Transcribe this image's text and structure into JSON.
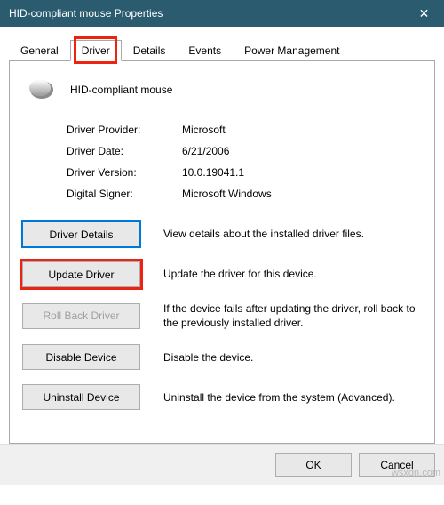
{
  "titlebar": {
    "text": "HID-compliant mouse Properties",
    "close_glyph": "✕"
  },
  "tabs": {
    "general": "General",
    "driver": "Driver",
    "details": "Details",
    "events": "Events",
    "power": "Power Management"
  },
  "device": {
    "name": "HID-compliant mouse"
  },
  "info": {
    "provider_label": "Driver Provider:",
    "provider_value": "Microsoft",
    "date_label": "Driver Date:",
    "date_value": "6/21/2006",
    "version_label": "Driver Version:",
    "version_value": "10.0.19041.1",
    "signer_label": "Digital Signer:",
    "signer_value": "Microsoft Windows"
  },
  "buttons": {
    "details_label": "Driver Details",
    "details_desc": "View details about the installed driver files.",
    "update_label": "Update Driver",
    "update_desc": "Update the driver for this device.",
    "rollback_label": "Roll Back Driver",
    "rollback_desc": "If the device fails after updating the driver, roll back to the previously installed driver.",
    "disable_label": "Disable Device",
    "disable_desc": "Disable the device.",
    "uninstall_label": "Uninstall Device",
    "uninstall_desc": "Uninstall the device from the system (Advanced)."
  },
  "footer": {
    "ok": "OK",
    "cancel": "Cancel"
  },
  "watermark": "wsxdn.com"
}
